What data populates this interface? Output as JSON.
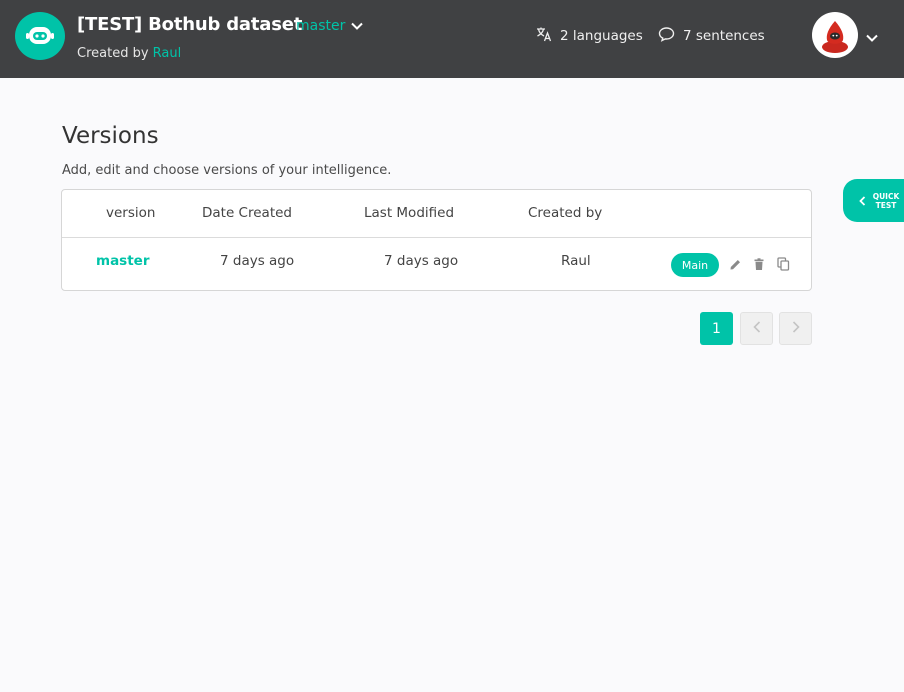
{
  "header": {
    "title": "[TEST] Bothub dataset",
    "branch": "master",
    "created_by_prefix": "Created by",
    "created_by_user": "Raul",
    "languages": "2 languages",
    "sentences": "7 sentences"
  },
  "main": {
    "title": "Versions",
    "subtitle": "Add, edit and choose versions of your intelligence.",
    "columns": [
      "version",
      "Date Created",
      "Last Modified",
      "Created by"
    ],
    "rows": [
      {
        "version": "master",
        "date_created": "7 days ago",
        "last_modified": "7 days ago",
        "created_by": "Raul",
        "badge": "Main"
      }
    ]
  },
  "pagination": {
    "current": "1"
  },
  "quick_test": {
    "label": "QUICK\nTEST"
  },
  "colors": {
    "accent": "#00c3a8",
    "header_bg": "#404143"
  },
  "icons": [
    "bot-logo-icon",
    "chevron-down-icon",
    "translate-icon",
    "chat-icon",
    "user-avatar-icon",
    "edit-icon",
    "trash-icon",
    "copy-icon",
    "chevron-left-icon",
    "chevron-right-icon"
  ]
}
